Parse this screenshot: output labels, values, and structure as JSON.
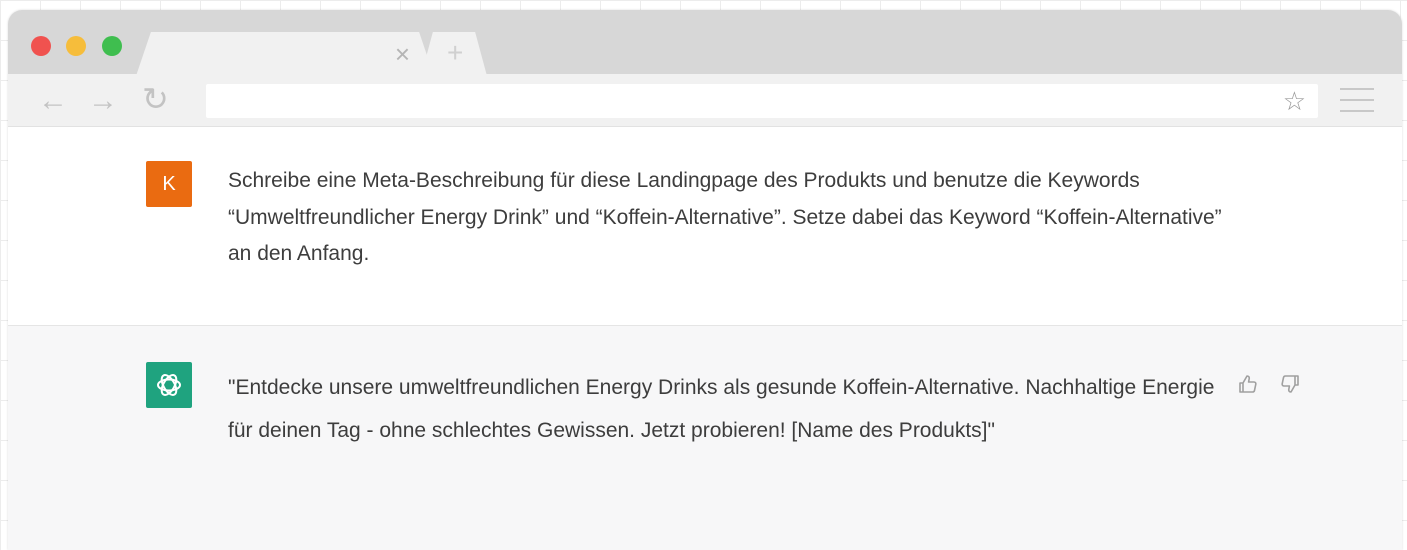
{
  "browser": {
    "tab_close": "×",
    "new_tab": "+",
    "nav": {
      "back": "←",
      "forward": "→",
      "reload": "↻"
    },
    "star": "☆"
  },
  "conversation": {
    "user": {
      "avatar_letter": "K",
      "avatar_color": "#ea6b11",
      "text": "Schreibe eine Meta-Beschreibung für diese Landingpage des Produkts und benutze die Keywords “Umweltfreundlicher Energy Drink” und “Koffein-Alternative”. Setze dabei das Keyword “Koffein-Alternative” an den Anfang."
    },
    "assistant": {
      "avatar_color": "#1fa37f",
      "text": "\"Entdecke unsere umweltfreundlichen Energy Drinks als gesunde Koffein-Alternative. Nachhaltige Energie für deinen Tag - ohne schlechtes Gewissen. Jetzt probieren! [Name des Produkts]\""
    }
  },
  "icons": {
    "user_avatar": "user-avatar",
    "assistant_avatar": "openai-logo-icon",
    "thumbs_up": "thumbs-up-icon",
    "thumbs_down": "thumbs-down-icon"
  }
}
